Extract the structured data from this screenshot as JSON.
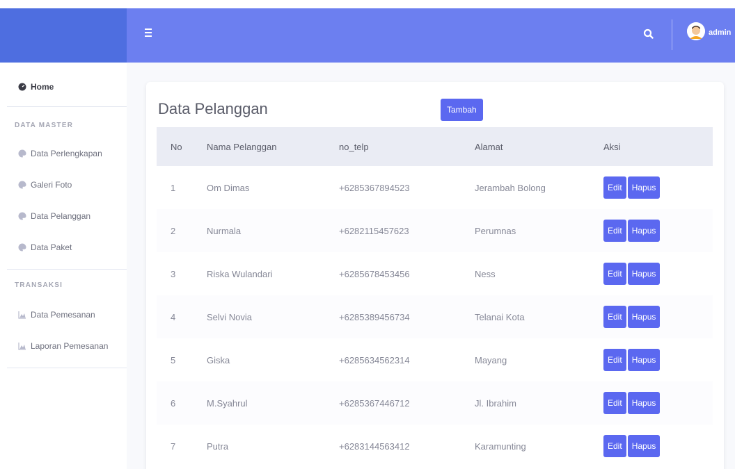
{
  "colors": {
    "brand": "#4e6ee0",
    "topbar": "#6c7ff0",
    "button": "#5b68f0"
  },
  "topbar": {
    "user_name": "admin"
  },
  "sidebar": {
    "home_label": "Home",
    "section_master": "DATA MASTER",
    "master_items": [
      "Data Perlengkapan",
      "Galeri Foto",
      "Data Pelanggan",
      "Data Paket"
    ],
    "section_transaksi": "TRANSAKSI",
    "transaksi_items": [
      "Data Pemesanan",
      "Laporan Pemesanan"
    ]
  },
  "main": {
    "title": "Data Pelanggan",
    "add_button": "Tambah",
    "table": {
      "headers": [
        "No",
        "Nama Pelanggan",
        "no_telp",
        "Alamat",
        "Aksi"
      ],
      "edit_label": "Edit",
      "delete_label": "Hapus",
      "rows": [
        {
          "no": "1",
          "nama": "Om Dimas",
          "telp": "+6285367894523",
          "alamat": "Jerambah Bolong"
        },
        {
          "no": "2",
          "nama": "Nurmala",
          "telp": "+6282115457623",
          "alamat": "Perumnas"
        },
        {
          "no": "3",
          "nama": "Riska Wulandari",
          "telp": "+6285678453456",
          "alamat": "Ness"
        },
        {
          "no": "4",
          "nama": "Selvi Novia",
          "telp": "+6285389456734",
          "alamat": "Telanai Kota"
        },
        {
          "no": "5",
          "nama": "Giska",
          "telp": "+6285634562314",
          "alamat": "Mayang"
        },
        {
          "no": "6",
          "nama": "M.Syahrul",
          "telp": "+6285367446712",
          "alamat": "Jl. Ibrahim"
        },
        {
          "no": "7",
          "nama": "Putra",
          "telp": "+6283144563412",
          "alamat": "Karamunting"
        }
      ]
    }
  }
}
